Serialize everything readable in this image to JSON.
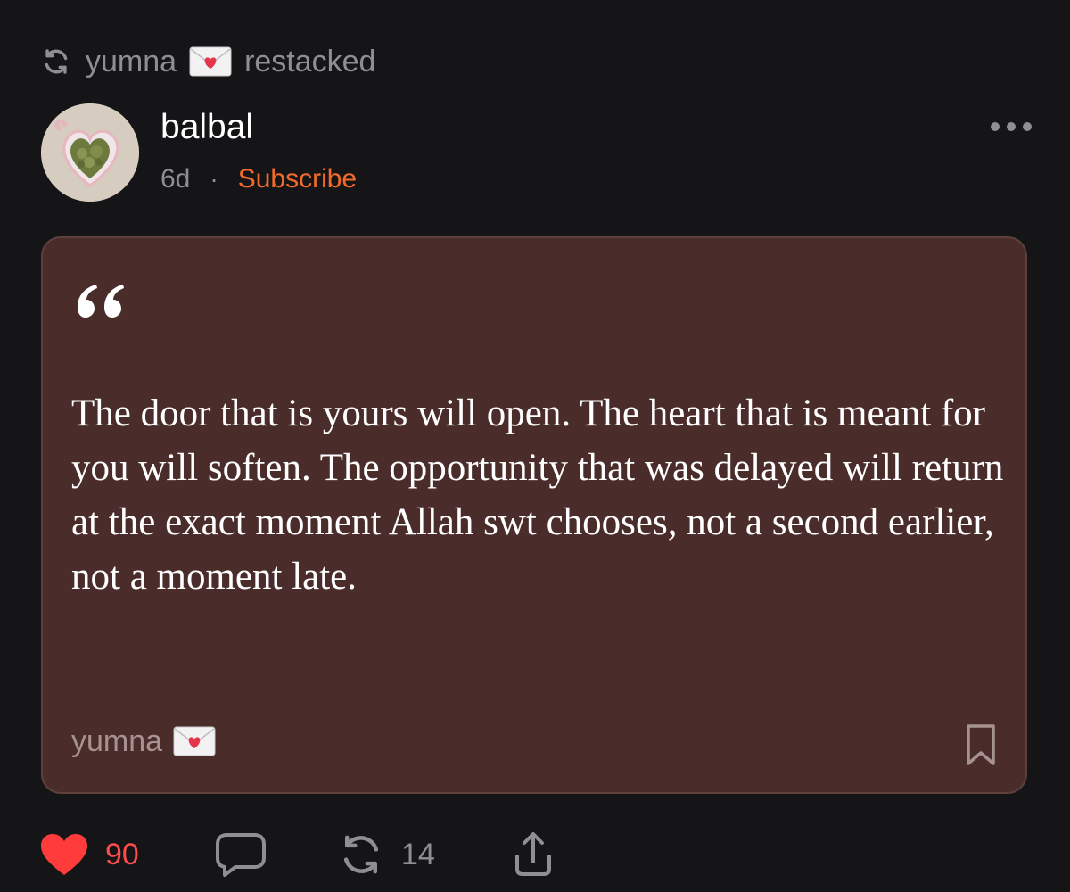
{
  "restack": {
    "icon": "restack-icon",
    "user": "yumna",
    "badge_icon": "love-letter-icon",
    "action_label": "restacked"
  },
  "author": {
    "name": "balbal",
    "avatar_icon": "avatar-matcha-dish",
    "time": "6d",
    "separator": "·",
    "subscribe_label": "Subscribe",
    "subscribe_color": "#f26b2a"
  },
  "more_menu": {
    "icon": "ellipsis-icon"
  },
  "quote": {
    "icon": "quote-mark-icon",
    "text": "The door that is yours will open. The heart that is meant for you will soften. The opportunity that was delayed will return at the exact moment Allah swt chooses, not a second earlier, not a moment late.",
    "author": "yumna",
    "author_badge_icon": "love-letter-icon",
    "bookmark_icon": "bookmark-icon",
    "card_color": "#4a2c2a"
  },
  "actions": {
    "like": {
      "icon": "heart-icon",
      "count": "90",
      "color": "#ff4b4b"
    },
    "comment": {
      "icon": "comment-icon"
    },
    "restack": {
      "icon": "restack-icon",
      "count": "14"
    },
    "share": {
      "icon": "share-icon"
    }
  }
}
